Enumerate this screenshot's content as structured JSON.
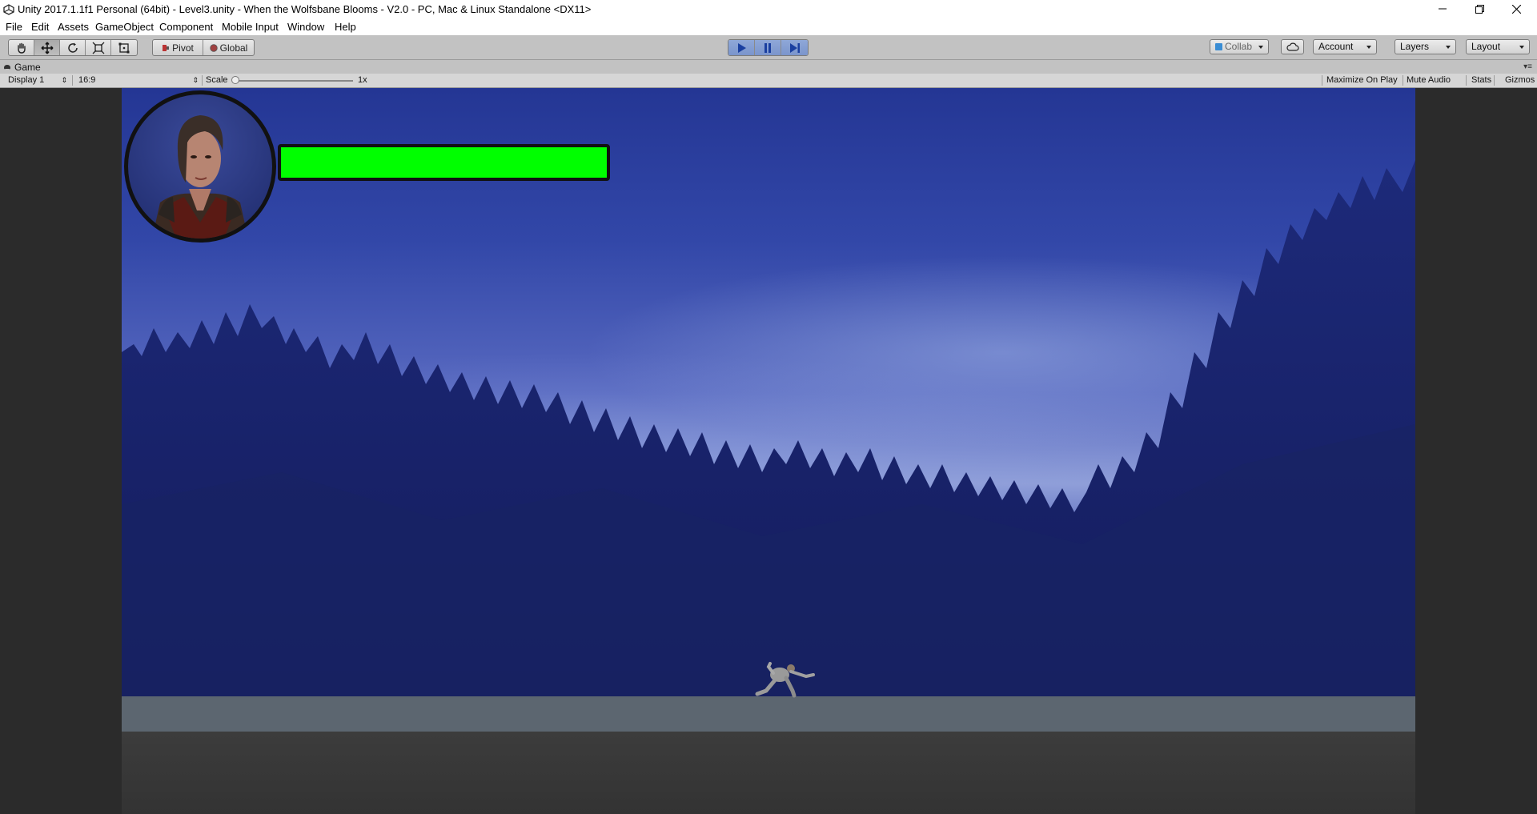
{
  "window": {
    "title": "Unity 2017.1.1f1 Personal (64bit) - Level3.unity - When the Wolfsbane Blooms - V2.0 - PC, Mac & Linux Standalone <DX11>",
    "controls": {
      "minimize_icon": "minimize-icon",
      "maximize_icon": "restore-icon",
      "close_icon": "close-icon"
    }
  },
  "menu": {
    "items": [
      "File",
      "Edit",
      "Assets",
      "GameObject",
      "Component",
      "Mobile Input",
      "Window",
      "Help"
    ]
  },
  "toolbar": {
    "tools": [
      "hand-tool-icon",
      "move-tool-icon",
      "rotate-tool-icon",
      "scale-tool-icon",
      "rect-tool-icon"
    ],
    "active_tool": "move-tool-icon",
    "pivot_label": "Pivot",
    "global_label": "Global",
    "play_icons": [
      "play-icon",
      "pause-icon",
      "step-icon"
    ],
    "play_active": true,
    "collab_label": "Collab",
    "cloud_icon": "cloud-icon",
    "account_label": "Account",
    "layers_label": "Layers",
    "layout_label": "Layout"
  },
  "game_tab": {
    "label": "Game",
    "display_label": "Display 1",
    "aspect_label": "16:9",
    "scale_label": "Scale",
    "scale_value_label": "1x",
    "scale_value": 1,
    "maximize_label": "Maximize On Play",
    "mute_label": "Mute Audio",
    "stats_label": "Stats",
    "gizmos_label": "Gizmos"
  },
  "game": {
    "health_fill_fraction": 1.0,
    "health_color": "#00ff00",
    "portrait": "player-portrait",
    "character": "player-character"
  },
  "colors": {
    "accent_play": "#7a95cc",
    "toolbar_bg": "#c2c2c2"
  }
}
